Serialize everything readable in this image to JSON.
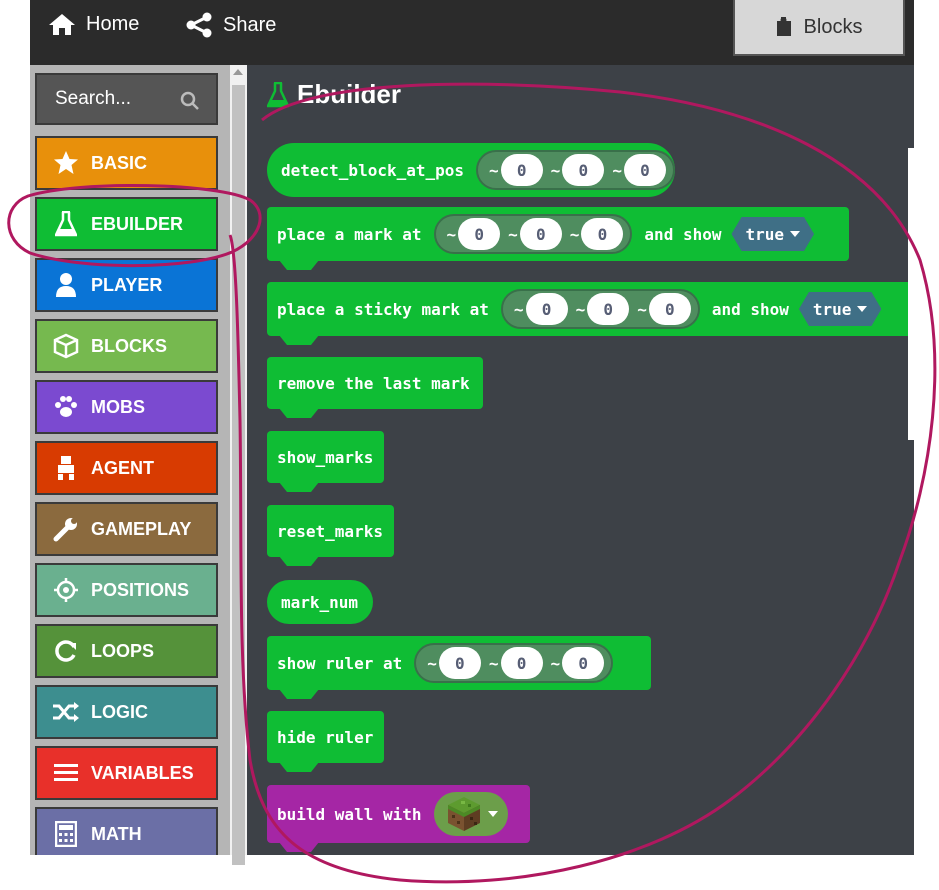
{
  "topbar": {
    "home_label": "Home",
    "share_label": "Share",
    "blocks_tab_label": "Blocks"
  },
  "search": {
    "placeholder": "Search..."
  },
  "categories": [
    {
      "label": "BASIC",
      "color": "#e8900b",
      "icon": "star-icon"
    },
    {
      "label": "EBUILDER",
      "color": "#0fbd34",
      "icon": "flask-icon"
    },
    {
      "label": "PLAYER",
      "color": "#0a74d6",
      "icon": "person-icon"
    },
    {
      "label": "BLOCKS",
      "color": "#76b94f",
      "icon": "cube-icon"
    },
    {
      "label": "MOBS",
      "color": "#7b4ad0",
      "icon": "paw-icon"
    },
    {
      "label": "AGENT",
      "color": "#d83b01",
      "icon": "robot-icon"
    },
    {
      "label": "GAMEPLAY",
      "color": "#8b6a3e",
      "icon": "wrench-icon"
    },
    {
      "label": "POSITIONS",
      "color": "#6ab08f",
      "icon": "crosshair-icon"
    },
    {
      "label": "LOOPS",
      "color": "#55923a",
      "icon": "loop-icon"
    },
    {
      "label": "LOGIC",
      "color": "#3d8e8f",
      "icon": "shuffle-icon"
    },
    {
      "label": "VARIABLES",
      "color": "#e8302a",
      "icon": "list-icon"
    },
    {
      "label": "MATH",
      "color": "#6b6fa6",
      "icon": "calculator-icon"
    }
  ],
  "workspace": {
    "title": "Ebuilder",
    "blocks": {
      "detect": {
        "label": "detect_block_at_pos",
        "x": "0",
        "y": "0",
        "z": "0"
      },
      "place_mark": {
        "label": "place a mark at",
        "x": "0",
        "y": "0",
        "z": "0",
        "and_show": "and show",
        "bool": "true"
      },
      "place_sticky": {
        "label": "place a sticky mark at",
        "x": "0",
        "y": "0",
        "z": "0",
        "and_show": "and show",
        "bool": "true"
      },
      "remove_last": {
        "label": "remove the last mark"
      },
      "show_marks": {
        "label": "show_marks"
      },
      "reset_marks": {
        "label": "reset_marks"
      },
      "mark_num": {
        "label": "mark_num"
      },
      "show_ruler": {
        "label": "show ruler at",
        "x": "0",
        "y": "0",
        "z": "0"
      },
      "hide_ruler": {
        "label": "hide ruler"
      },
      "build_wall": {
        "label": "build wall with"
      }
    },
    "tilde": "~"
  },
  "colors": {
    "ebuilder_green": "#0fbd34",
    "annotation": "#b0185f",
    "workspace_bg": "#3d4147"
  }
}
